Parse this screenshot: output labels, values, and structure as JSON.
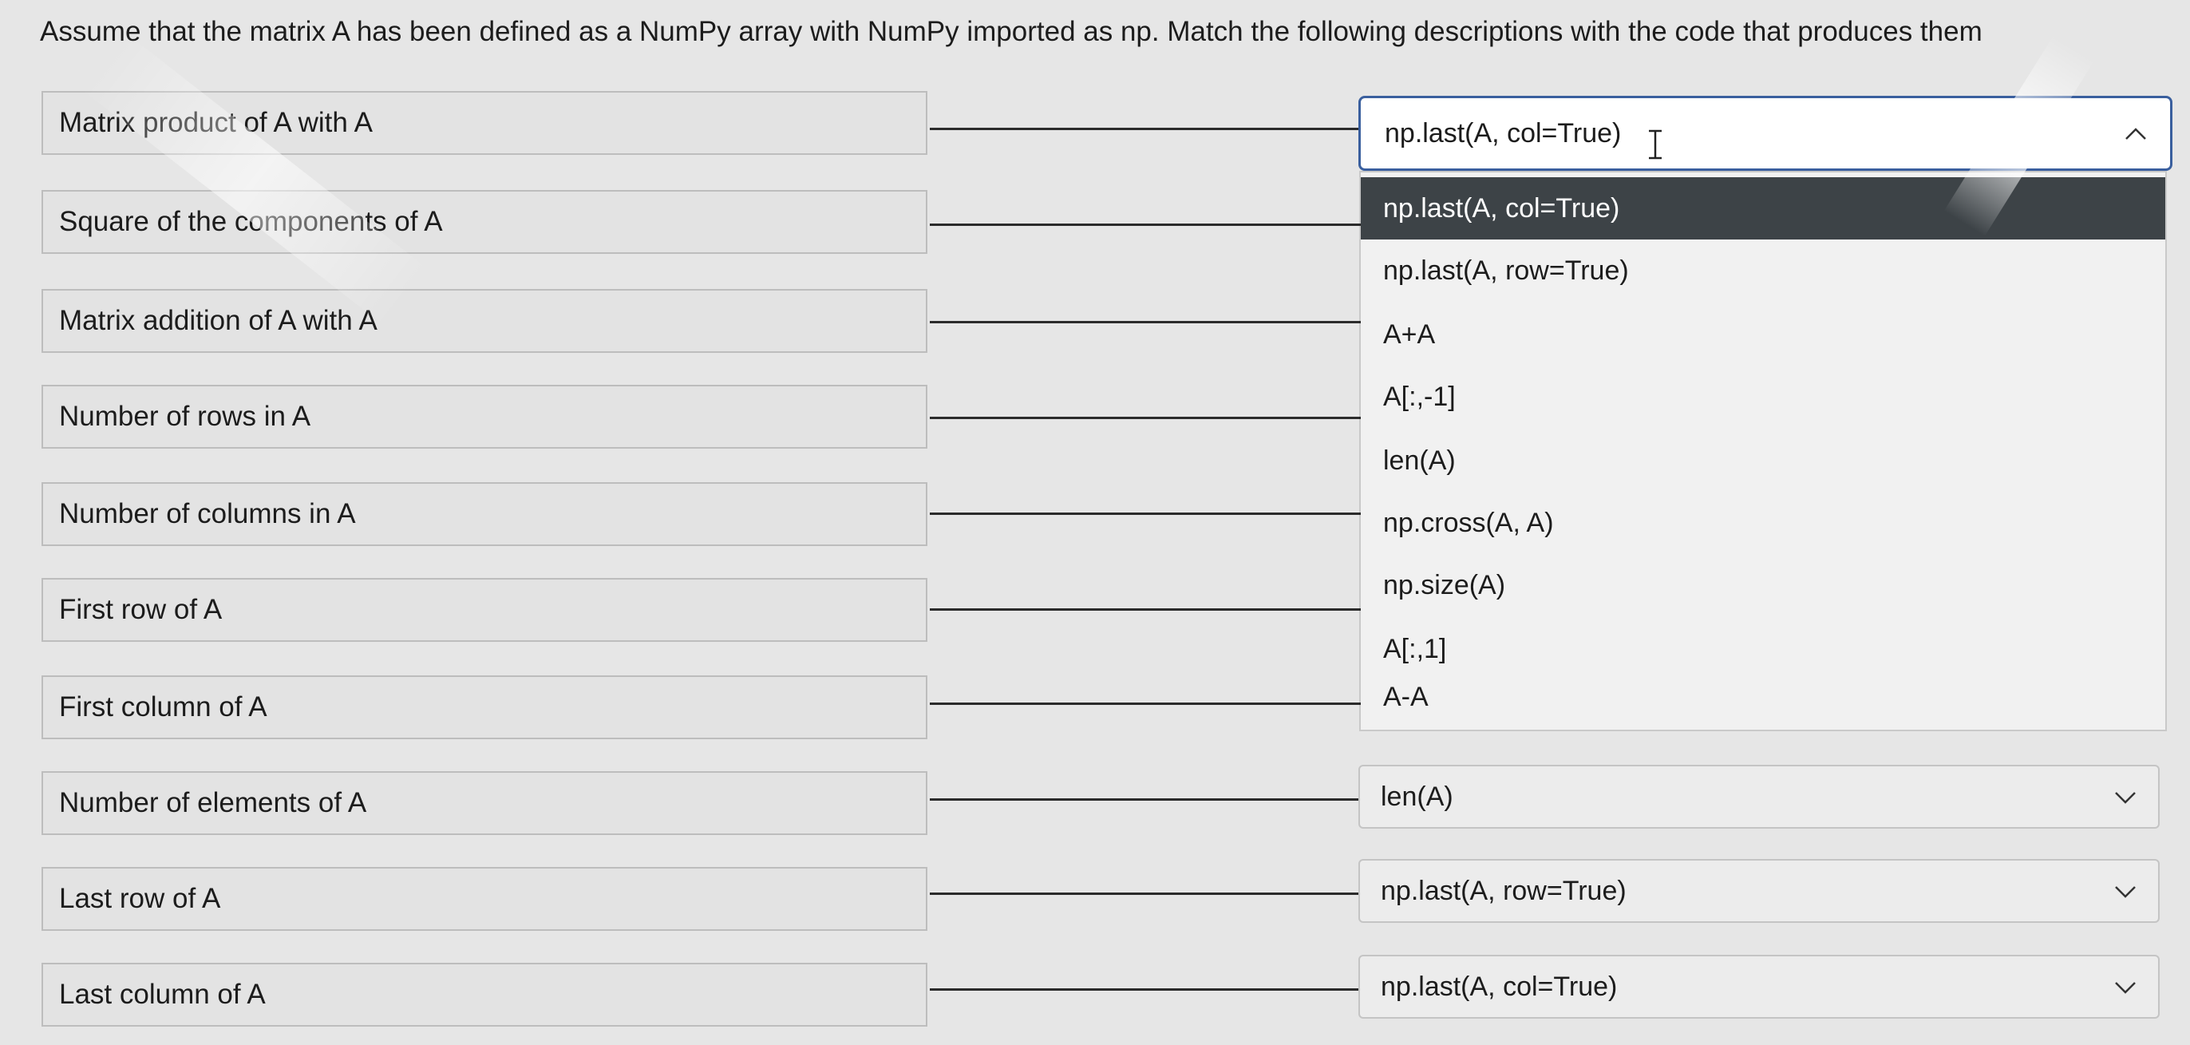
{
  "question": "Assume that the matrix A has been defined as a NumPy array with NumPy imported as np. Match the following descriptions with the code that produces them",
  "rows": [
    {
      "description": "Matrix product of A with A",
      "answer": "np.last(A, col=True)"
    },
    {
      "description": "Square of the components of A",
      "answer": ""
    },
    {
      "description": "Matrix addition of A with A",
      "answer": ""
    },
    {
      "description": "Number of rows in A",
      "answer": ""
    },
    {
      "description": "Number of columns in A",
      "answer": ""
    },
    {
      "description": "First row of A",
      "answer": ""
    },
    {
      "description": "First column of A",
      "answer": ""
    },
    {
      "description": "Number of elements of A",
      "answer": "len(A)"
    },
    {
      "description": "Last row of A",
      "answer": "np.last(A, row=True)"
    },
    {
      "description": "Last column of A",
      "answer": "np.last(A, col=True)"
    }
  ],
  "dropdown": {
    "selected_label": "np.last(A, col=True)",
    "options": [
      "np.last(A, col=True)",
      "np.last(A, row=True)",
      "A+A",
      "A[:,-1]",
      "len(A)",
      "np.cross(A, A)",
      "np.size(A)",
      "A[:,1]",
      "A-A"
    ]
  },
  "icons": {
    "open_chevron": "chevron-up-icon",
    "closed_chevron": "chevron-down-icon",
    "cursor": "text-cursor-icon"
  },
  "colors": {
    "selected_option_bg": "#3d4347",
    "focus_border": "#3a5f9e"
  }
}
